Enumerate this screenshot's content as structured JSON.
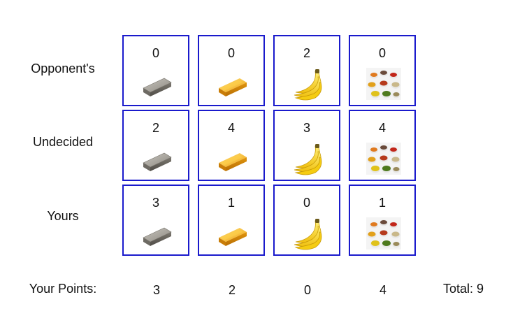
{
  "rows": [
    {
      "label": "Opponent's",
      "counts": [
        "0",
        "0",
        "2",
        "0"
      ]
    },
    {
      "label": "Undecided",
      "counts": [
        "2",
        "4",
        "3",
        "4"
      ]
    },
    {
      "label": "Yours",
      "counts": [
        "3",
        "1",
        "0",
        "1"
      ]
    }
  ],
  "items": [
    {
      "icon": "silver-bar-icon"
    },
    {
      "icon": "gold-bar-icon"
    },
    {
      "icon": "bananas-icon"
    },
    {
      "icon": "spices-icon"
    }
  ],
  "points": {
    "label": "Your Points:",
    "values": [
      "3",
      "2",
      "0",
      "4"
    ],
    "total": "Total: 9"
  },
  "colors": {
    "cell_border": "#1a1acc",
    "silver": "#8e8a83",
    "gold": "#f2b21e",
    "banana": "#f7d21c"
  }
}
